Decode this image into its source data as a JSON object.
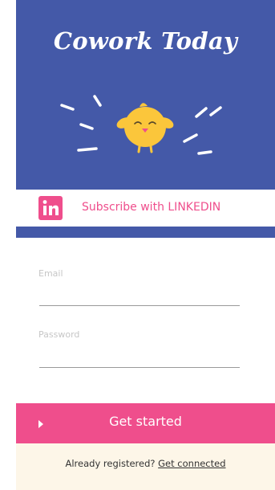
{
  "app": {
    "title": "Cowork Today"
  },
  "social": {
    "linkedin_label": "Subscribe with LINKEDIN",
    "linkedin_icon": "linkedin-icon"
  },
  "form": {
    "email_label": "Email",
    "email_value": "",
    "password_label": "Password",
    "password_value": ""
  },
  "cta": {
    "label": "Get started",
    "icon": "play-arrow-icon"
  },
  "footer": {
    "prompt": "Already registered?",
    "link": "Get connected"
  },
  "colors": {
    "hero_blue": "#4459a8",
    "accent_pink": "#ef4e8c",
    "cream": "#fdf6e8",
    "mascot_yellow": "#fbc63b"
  }
}
